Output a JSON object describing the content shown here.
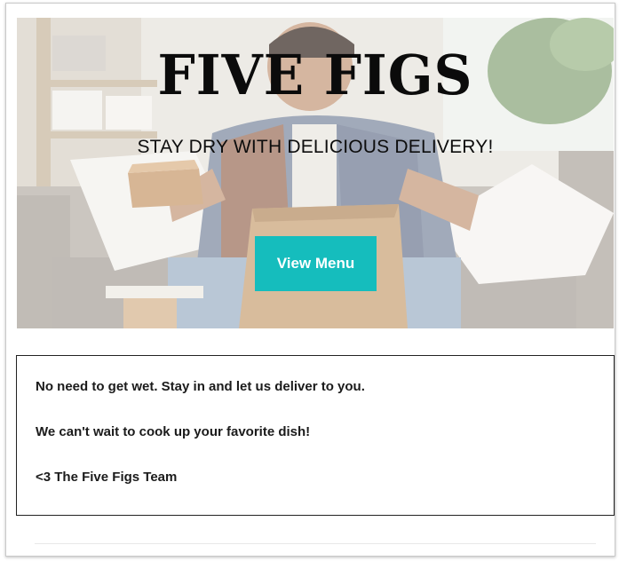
{
  "hero": {
    "title": "FIVE FIGS",
    "subtitle": "STAY DRY WITH DELICIOUS DELIVERY!",
    "button_label": "View Menu",
    "button_color": "#15bdbd"
  },
  "message": {
    "lines": [
      "No need to get wet. Stay in and let us deliver to you.",
      "We can't wait to cook up your favorite dish!",
      "<3 The Five Figs Team"
    ]
  }
}
